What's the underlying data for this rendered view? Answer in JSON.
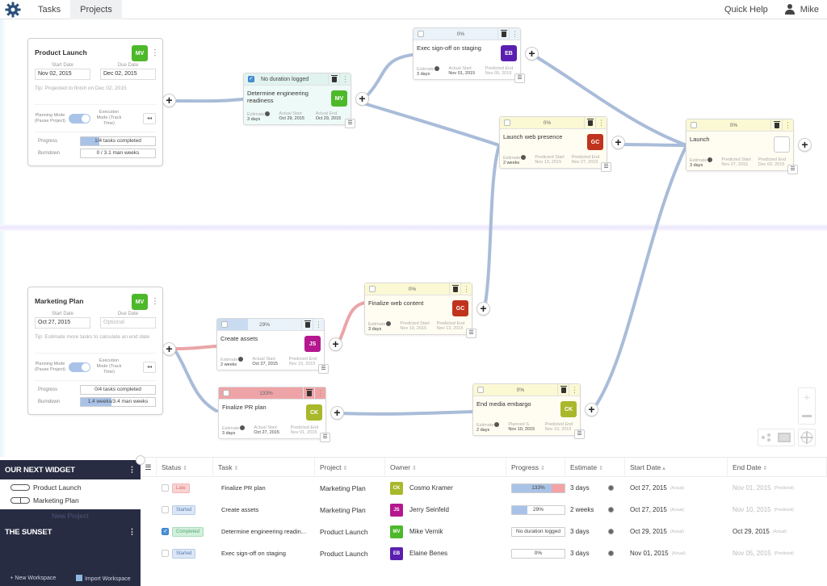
{
  "nav": {
    "tabs": [
      {
        "label": "Tasks",
        "active": false
      },
      {
        "label": "Projects",
        "active": true
      }
    ],
    "quick_help": "Quick Help",
    "user": "Mike",
    "icons": {
      "logo": "gear-logo-icon",
      "user": "user-icon"
    }
  },
  "projects": [
    {
      "title": "Product Launch",
      "owner_initials": "MV",
      "owner_color": "#4db82a",
      "start_label": "Start Date",
      "start_value": "Nov 02, 2015",
      "due_label": "Due Date",
      "due_value": "Dec 02, 2015",
      "tip": "Tip: Projected to finish on Dec 02, 2015",
      "planning_mode": "Planning Mode (Pause Project)",
      "execution_mode": "Execution Mode (Track Time)",
      "rewind": "◂◂",
      "progress_label": "Progress",
      "progress_text": "1/4 tasks completed",
      "progress_fraction": 0.25,
      "burndown_label": "Burndown",
      "burndown_text": "0 / 3.1 man weeks",
      "burndown_fraction": 0
    },
    {
      "title": "Marketing Plan",
      "owner_initials": "MV",
      "owner_color": "#4db82a",
      "start_label": "Start Date",
      "start_value": "Oct 27, 2015",
      "due_label": "Due Date",
      "due_placeholder": "Optional",
      "tip": "Tip: Estimate more tasks to calculate an end date",
      "planning_mode": "Planning Mode (Pause Project)",
      "execution_mode": "Execution Mode (Track Time)",
      "rewind": "◂◂",
      "progress_label": "Progress",
      "progress_text": "0/4 tasks completed",
      "progress_fraction": 0,
      "burndown_label": "Burndown",
      "burndown_text": "1.4 weeks/3.4 man weeks",
      "burndown_fraction": 0.41
    }
  ],
  "tasks": {
    "engineering": {
      "header": "No duration logged",
      "checked": true,
      "title": "Determine engineering readiness",
      "owner": "MV",
      "owner_color": "#4db82a",
      "c1_label": "Estimate",
      "c1_value": "3 days",
      "c2_label": "Actual Start",
      "c2_value": "Oct 29, 2015",
      "c3_label": "Actual End",
      "c3_value": "Oct 29, 2015"
    },
    "exec": {
      "header": "0%",
      "checked": false,
      "progress": 0,
      "title": "Exec sign-off on staging",
      "owner": "EB",
      "owner_color": "#5a1fb0",
      "c1_label": "Estimate",
      "c1_value": "3 days",
      "c2_label": "Actual Start",
      "c2_value": "Nov 01, 2015",
      "c3_label": "Predicted End",
      "c3_value": "Nov 05, 2015"
    },
    "web_presence": {
      "header": "0%",
      "checked": false,
      "progress": 0,
      "title": "Launch web presence",
      "owner": "GC",
      "owner_color": "#c0341d",
      "c1_label": "Estimate",
      "c1_value": "2 weeks",
      "c2_label": "Predicted Start",
      "c2_value": "Nov 13, 2015",
      "c3_label": "Predicted End",
      "c3_value": "Nov 27, 2015"
    },
    "launch": {
      "header": "0%",
      "checked": false,
      "progress": 0,
      "title": "Launch",
      "owner": "",
      "c1_label": "Estimate",
      "c1_value": "3 days",
      "c2_label": "Predicted Start",
      "c2_value": "Nov 27, 2015",
      "c3_label": "Predicted End",
      "c3_value": "Dec 02, 2015"
    },
    "web_content": {
      "header": "0%",
      "checked": false,
      "progress": 0,
      "title": "Finalize web content",
      "owner": "GC",
      "owner_color": "#c0341d",
      "c1_label": "Estimate",
      "c1_value": "3 days",
      "c2_label": "Predicted Start",
      "c2_value": "Nov 10, 2015",
      "c3_label": "Predicted End",
      "c3_value": "Nov 13, 2015"
    },
    "assets": {
      "header": "29%",
      "checked": false,
      "progress": 0.29,
      "title": "Create assets",
      "owner": "JS",
      "owner_color": "#b5178f",
      "c1_label": "Estimate",
      "c1_value": "2 weeks",
      "c2_label": "Actual Start",
      "c2_value": "Oct 27, 2015",
      "c3_label": "Predicted End",
      "c3_value": "Nov 10, 2015"
    },
    "pr_plan": {
      "header": "133%",
      "checked": false,
      "progress": 1.33,
      "title": "Finalize PR plan",
      "owner": "CK",
      "owner_color": "#a9b82a",
      "c1_label": "Estimate",
      "c1_value": "3 days",
      "c2_label": "Actual Start",
      "c2_value": "Oct 27, 2015",
      "c3_label": "Predicted End",
      "c3_value": "Nov 01, 2015"
    },
    "embargo": {
      "header": "0%",
      "checked": false,
      "progress": 0,
      "title": "End media embargo",
      "owner": "CK",
      "owner_color": "#a9b82a",
      "c1_label": "Estimate",
      "c1_value": "2 days",
      "c2_label": "Planned S.",
      "c2_value": "Nov 10, 2015",
      "c3_label": "Predicted End",
      "c3_value": "Nov 10, 2015"
    }
  },
  "canvas_controls": {
    "zoom_in": "+",
    "zoom_out": "−",
    "icons": [
      "share-graph-icon",
      "screen-icon",
      "target-icon"
    ]
  },
  "sidebar": {
    "workspaces": [
      {
        "name": "OUR NEXT WIDGET",
        "projects": [
          "Product Launch",
          "Marketing Plan"
        ],
        "new_project": "New Project"
      },
      {
        "name": "THE SUNSET",
        "projects": []
      }
    ],
    "new_workspace": "+ New Workspace",
    "import_workspace": "Import Workspace"
  },
  "table": {
    "columns": [
      "Status",
      "Task",
      "Project",
      "Owner",
      "Progress",
      "Estimate",
      "Start Date",
      "End Date"
    ],
    "sort_indicators": [
      "⇕",
      "⇕",
      "⇕",
      "⇕",
      "⇕",
      "⇕",
      "▴",
      "⇕"
    ],
    "rows": [
      {
        "checked": false,
        "status": "Late",
        "status_kind": "late",
        "task": "Finalize PR plan",
        "project": "Marketing Plan",
        "owner_initials": "CK",
        "owner_color": "#a9b82a",
        "owner": "Cosmo Kramer",
        "progress_text": "133%",
        "progress": 1.33,
        "estimate": "3 days",
        "start": "Oct 27, 2015",
        "start_tag": "(Actual)",
        "end": "Nov 01, 2015",
        "end_tag": "(Predicted)",
        "end_muted": true
      },
      {
        "checked": false,
        "status": "Started",
        "status_kind": "started",
        "task": "Create assets",
        "project": "Marketing Plan",
        "owner_initials": "JS",
        "owner_color": "#b5178f",
        "owner": "Jerry Seinfeld",
        "progress_text": "29%",
        "progress": 0.29,
        "estimate": "2 weeks",
        "start": "Oct 27, 2015",
        "start_tag": "(Actual)",
        "end": "Nov 10, 2015",
        "end_tag": "(Predicted)",
        "end_muted": true
      },
      {
        "checked": true,
        "status": "Completed",
        "status_kind": "completed",
        "task": "Determine engineering readin...",
        "project": "Product Launch",
        "owner_initials": "MV",
        "owner_color": "#4db82a",
        "owner": "Mike Vernik",
        "progress_text": "No duration logged",
        "progress": null,
        "estimate": "3 days",
        "start": "Oct 29, 2015",
        "start_tag": "(Actual)",
        "end": "Oct 29, 2015",
        "end_tag": "(Actual)",
        "end_muted": false
      },
      {
        "checked": false,
        "status": "Started",
        "status_kind": "started",
        "task": "Exec sign-off on staging",
        "project": "Product Launch",
        "owner_initials": "EB",
        "owner_color": "#5a1fb0",
        "owner": "Elaine Benes",
        "progress_text": "0%",
        "progress": 0,
        "estimate": "3 days",
        "start": "Nov 01, 2015",
        "start_tag": "(Actual)",
        "end": "Nov 05, 2015",
        "end_tag": "(Predicted)",
        "end_muted": true
      }
    ]
  },
  "colors": {
    "edge": "#a9bcd9",
    "edge_late": "#eaa5a8",
    "sidebar_bg": "#272c42"
  }
}
